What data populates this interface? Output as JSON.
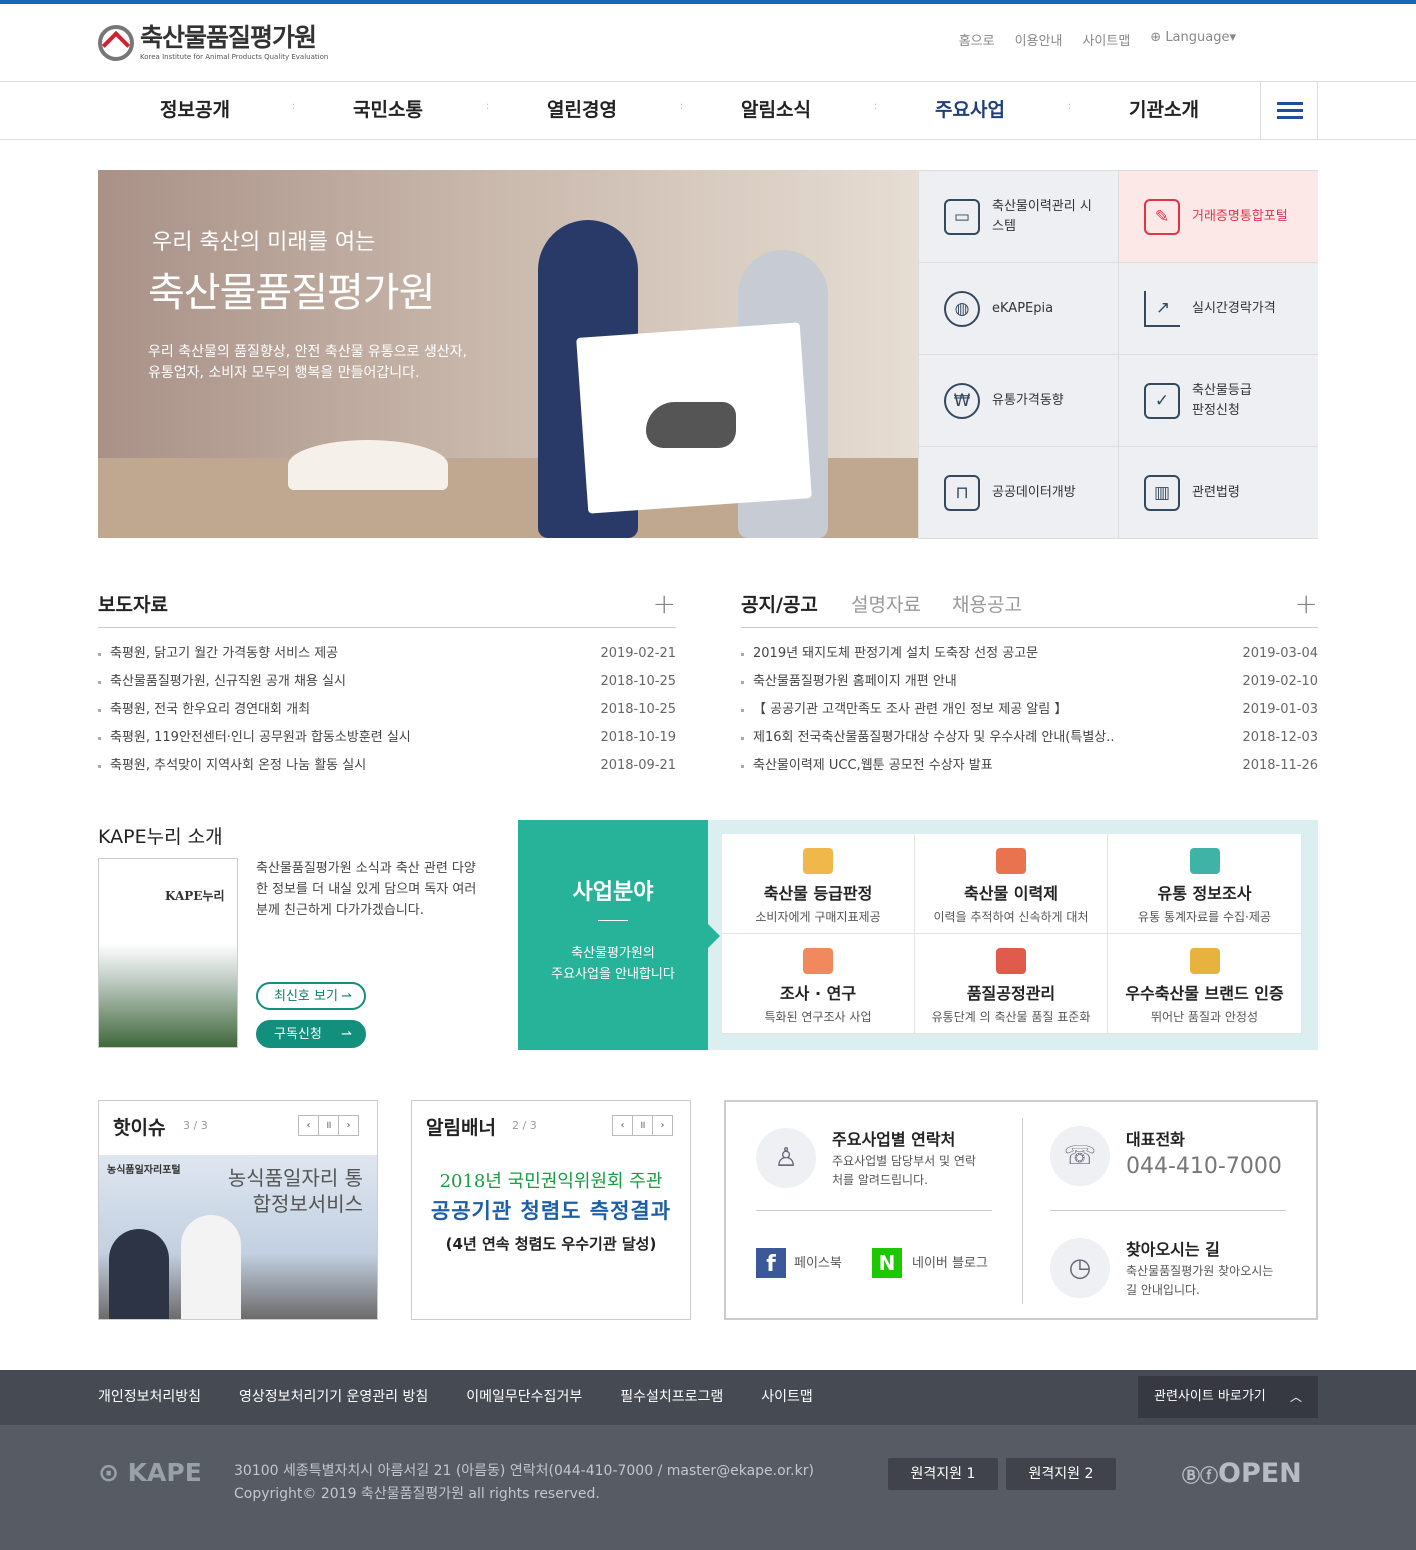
{
  "header": {
    "logo_title": "축산물품질평가원",
    "logo_sub": "Korea Institute for Animal Products Quality Evaluation",
    "util": [
      "홈으로",
      "이용안내",
      "사이트맵",
      "Language"
    ]
  },
  "gnb": [
    "정보공개",
    "국민소통",
    "열린경영",
    "알림소식",
    "주요사업",
    "기관소개"
  ],
  "hero": {
    "subtitle": "우리 축산의 미래를 여는",
    "title": "축산물품질평가원",
    "desc": "우리 축산물의 품질향상, 안전 축산물 유통으로 생산자, 유통업자, 소비자 모두의 행복을 만들어갑니다."
  },
  "quick": [
    {
      "label": "축산물이력관리 시스템",
      "icon": "monitor-icon"
    },
    {
      "label": "거래증명통합포털",
      "icon": "document-pen-icon"
    },
    {
      "label": "eKAPEpia",
      "icon": "globe-search-icon"
    },
    {
      "label": "실시간경락가격",
      "icon": "line-chart-icon"
    },
    {
      "label": "유통가격동향",
      "icon": "coins-icon"
    },
    {
      "label": "축산물등급 판정신청",
      "icon": "certificate-icon"
    },
    {
      "label": "공공데이터개방",
      "icon": "presentation-icon"
    },
    {
      "label": "관련법령",
      "icon": "books-icon"
    }
  ],
  "press": {
    "title": "보도자료",
    "items": [
      {
        "t": "축평원, 닭고기 월간 가격동향 서비스 제공",
        "d": "2019-02-21"
      },
      {
        "t": "축산물품질평가원, 신규직원 공개 채용 실시",
        "d": "2018-10-25"
      },
      {
        "t": "축평원, 전국 한우요리 경연대회 개최",
        "d": "2018-10-25"
      },
      {
        "t": "축평원, 119안전센터·인니 공무원과 합동소방훈련 실시",
        "d": "2018-10-19"
      },
      {
        "t": "축평원, 추석맞이 지역사회 온정 나눔 활동 실시",
        "d": "2018-09-21"
      }
    ]
  },
  "notice": {
    "tabs": [
      "공지/공고",
      "설명자료",
      "채용공고"
    ],
    "items": [
      {
        "t": "2019년 돼지도체 판정기계 설치 도축장 선정 공고문",
        "d": "2019-03-04"
      },
      {
        "t": "축산물품질평가원 홈페이지 개편 안내",
        "d": "2019-02-10"
      },
      {
        "t": "【 공공기관 고객만족도 조사 관련 개인 정보 제공 알림 】",
        "d": "2019-01-03"
      },
      {
        "t": "제16회 전국축산물품질평가대상 수상자 및 우수사례 안내(특별상..",
        "d": "2018-12-03"
      },
      {
        "t": "축산물이력제 UCC,웹툰 공모전 수상자 발표",
        "d": "2018-11-26"
      }
    ]
  },
  "kape": {
    "title": "KAPE누리 소개",
    "cover_logo": "KAPE누리",
    "desc": "축산물품질평가원 소식과 축산 관련 다양한 정보를 더 내실 있게 담으며 독자 여러분께 친근하게 다가가겠습니다.",
    "btn1": "최신호 보기",
    "btn2": "구독신청"
  },
  "biz": {
    "title": "사업분야",
    "desc1": "축산물평가원의",
    "desc2": "주요사업을 안내합니다",
    "items": [
      {
        "n": "축산물 등급판정",
        "s": "소비자에게 구매지표제공",
        "c": "#f0b84a"
      },
      {
        "n": "축산물 이력제",
        "s": "이력을 추적하여 신속하게 대처",
        "c": "#e9734f"
      },
      {
        "n": "유통 정보조사",
        "s": "유통 통계자료를 수집·제공",
        "c": "#3fb3a6"
      },
      {
        "n": "조사 · 연구",
        "s": "특화된 연구조사 사업",
        "c": "#f08a5d"
      },
      {
        "n": "품질공정관리",
        "s": "유통단계 의 축산물 품질 표준화",
        "c": "#e05b4b"
      },
      {
        "n": "우수축산물 브랜드 인증",
        "s": "뛰어난 품질과 안정성",
        "c": "#e8b23e"
      }
    ]
  },
  "hotissue": {
    "title": "핫이슈",
    "count": "3 / 3",
    "img_h1": "농식품일자리포털",
    "img_h2": "농식품일자리 통합정보서비스"
  },
  "alimbanner": {
    "title": "알림배너",
    "count": "2 / 3",
    "line1": "2018년 국민권익위원회 주관",
    "line2": "공공기관 청렴도 측정결과",
    "line3": "(4년 연속 청렴도 우수기관 달성)"
  },
  "contact": {
    "c1_title": "주요사업별 연락처",
    "c1_desc": "주요사업별 담당부서 및 연락처를 알려드립니다.",
    "c2_title": "대표전화",
    "c2_phone": "044-410-7000",
    "fb": "페이스북",
    "nb": "네이버 블로그",
    "c3_title": "찾아오시는 길",
    "c3_desc": "축산물품질평가원 찾아오시는 길 안내입니다."
  },
  "footer": {
    "links": [
      "개인정보처리방침",
      "영상정보처리기기 운영관리 방침",
      "이메일무단수집거부",
      "필수설치프로그램",
      "사이트맵"
    ],
    "related": "관련사이트 바로가기",
    "logo": "KAPE",
    "addr": "30100 세종특별자치시 아름서길 21 (아름동) 연락처(044-410-7000 / master@ekape.or.kr)",
    "copy": "Copyright© 2019 축산물품질평가원 all rights reserved.",
    "remote1": "원격지원 1",
    "remote2": "원격지원 2",
    "open": "OPEN"
  }
}
